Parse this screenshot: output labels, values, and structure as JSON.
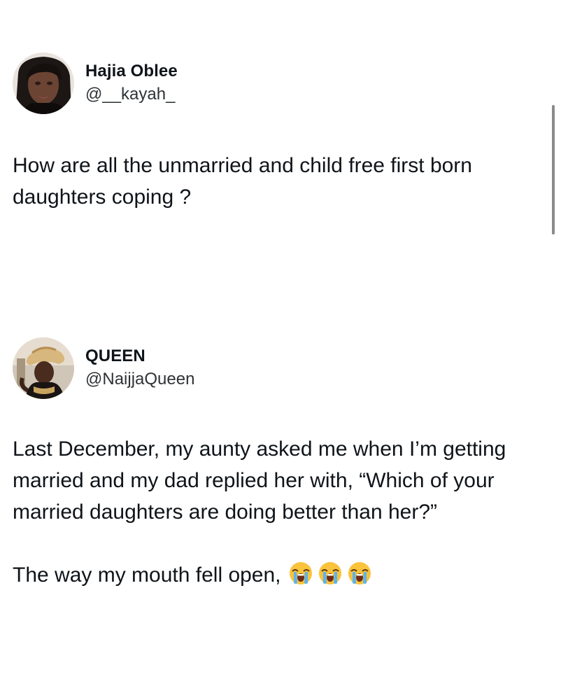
{
  "posts": [
    {
      "author": {
        "display_name": "Hajia Oblee",
        "handle": "@__kayah_",
        "avatar_icon": "profile-photo-avatar"
      },
      "paragraphs": [
        "How are all the unmarried and child free first born daughters coping ?"
      ]
    },
    {
      "author": {
        "display_name": "QUEEN",
        "handle": "@NaijjaQueen",
        "avatar_icon": "profile-photo-avatar"
      },
      "paragraphs": [
        "Last December, my aunty asked me when I’m getting married and my dad replied her with, “Which of your married daughters are doing better than her?”",
        "The way my mouth fell open,"
      ],
      "emojis": [
        "loudly-crying-face",
        "loudly-crying-face",
        "loudly-crying-face"
      ]
    }
  ],
  "scrollbar": {
    "position_fraction": 0.0,
    "visible_fraction": 1.0
  },
  "colors": {
    "text": "#0f1419",
    "handle": "#2f3336",
    "background": "#ffffff",
    "scrollbar": "#8b8b8b"
  }
}
